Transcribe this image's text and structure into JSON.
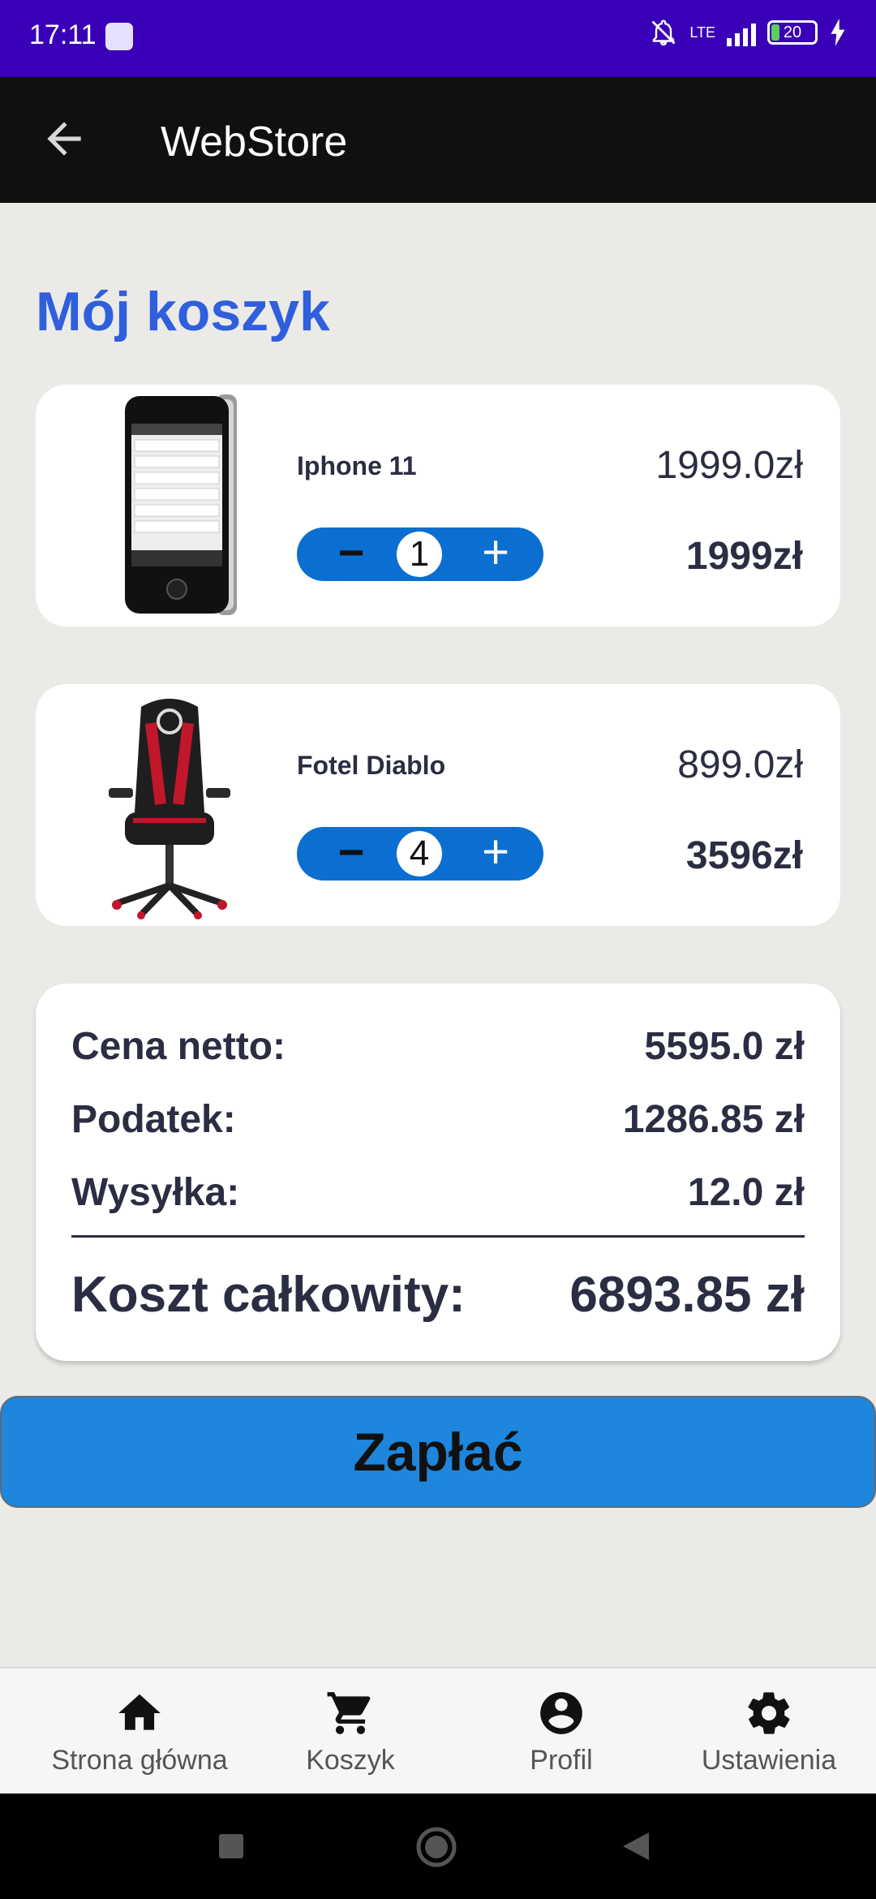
{
  "status_bar": {
    "time": "17:11",
    "network": "LTE",
    "battery": "20"
  },
  "app_bar": {
    "title": "WebStore",
    "back_icon": "arrow-left-icon"
  },
  "page": {
    "title": "Mój koszyk"
  },
  "cart": {
    "items": [
      {
        "name": "Iphone 11",
        "unit_price": "1999.0zł",
        "quantity": "1",
        "line_total": "1999zł",
        "image": "phone-icon"
      },
      {
        "name": "Fotel Diablo",
        "unit_price": "899.0zł",
        "quantity": "4",
        "line_total": "3596zł",
        "image": "gaming-chair-icon"
      }
    ],
    "minus_label": "−",
    "plus_label": "+"
  },
  "summary": {
    "net_label": "Cena netto:",
    "net_value": "5595.0 zł",
    "tax_label": "Podatek:",
    "tax_value": "1286.85 zł",
    "shipping_label": "Wysyłka:",
    "shipping_value": "12.0 zł",
    "total_label": "Koszt całkowity:",
    "total_value": "6893.85 zł"
  },
  "pay_button": {
    "label": "Zapłać"
  },
  "bottom_nav": {
    "items": [
      {
        "label": "Strona główna",
        "icon": "home-icon"
      },
      {
        "label": "Koszyk",
        "icon": "cart-icon"
      },
      {
        "label": "Profil",
        "icon": "account-circle-icon"
      },
      {
        "label": "Ustawienia",
        "icon": "gear-icon"
      }
    ]
  },
  "colors": {
    "status_bar": "#3a00b8",
    "app_bar": "#101010",
    "title_accent": "#2f5fdc",
    "stepper": "#0a6fd0",
    "pay_button": "#1e86dc",
    "background": "#ebeae6"
  }
}
